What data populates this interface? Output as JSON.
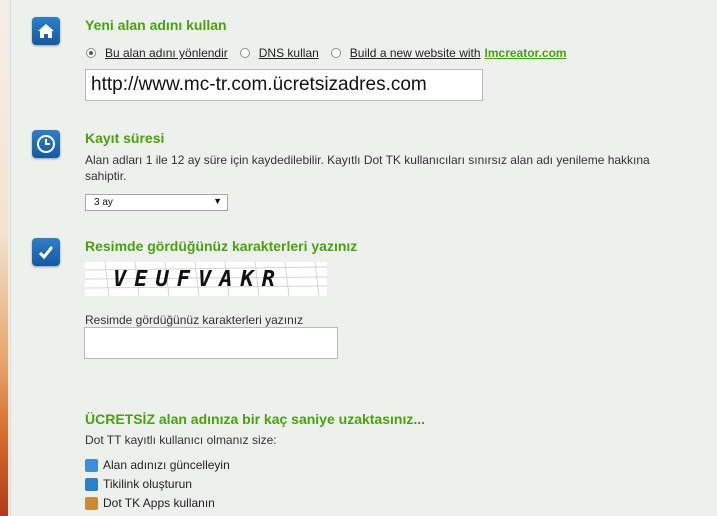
{
  "section_domain": {
    "title": "Yeni alan adını kullan",
    "icon": "home-icon",
    "options": [
      {
        "label": "Bu alan adını yönlendir",
        "checked": true
      },
      {
        "label": "DNS kullan",
        "checked": false
      },
      {
        "label": "Build a new website with",
        "brand": "Imcreator.com",
        "checked": false
      }
    ],
    "url_value": "http://www.mc-tr.com.ücretsizadres.com"
  },
  "section_period": {
    "title": "Kayıt süresi",
    "icon": "clock-icon",
    "description": "Alan adları 1 ile 12 ay süre için kaydedilebilir. Kayıtlı Dot TK kullanıcıları sınırsız alan adı yenileme hakkına sahiptir.",
    "selected": "3 ay"
  },
  "section_captcha": {
    "title": "Resimde gördüğünüz karakterleri yazınız",
    "icon": "checkmark-icon",
    "captcha_text": "VEUFVAKR",
    "input_label": "Resimde gördüğünüz karakterleri yazınız",
    "input_value": ""
  },
  "section_benefits": {
    "title": "ÜCRETSİZ alan adınıza bir kaç saniye uzaktasınız...",
    "subtitle": "Dot TT kayıtlı kullanıcı olmanız size:",
    "items": [
      {
        "label": "Alan adınızı güncelleyin",
        "icon": "refresh-icon",
        "color": "#3b8fd6"
      },
      {
        "label": "Tikilink oluşturun",
        "icon": "link-icon",
        "color": "#2d7fc8"
      },
      {
        "label": "Dot TK Apps kullanın",
        "icon": "apps-icon",
        "color": "#c98a3a"
      }
    ]
  },
  "colors": {
    "accent": "#4aa10f",
    "icon_bg": "#1f6db3"
  }
}
